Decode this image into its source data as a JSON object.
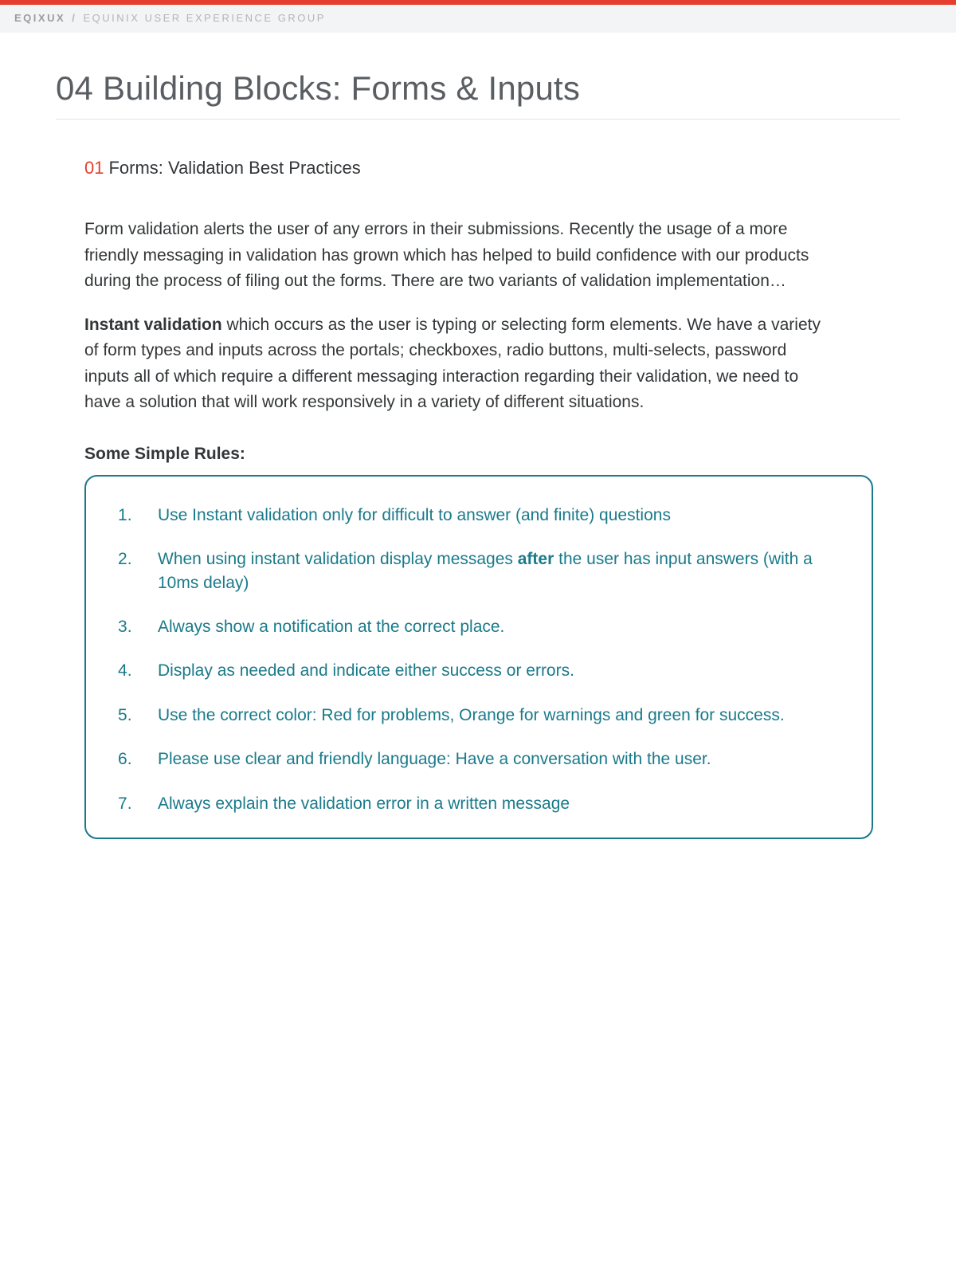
{
  "colors": {
    "accent_red": "#e53e2e",
    "rule_teal": "#1a7a8a",
    "header_bg": "#f3f4f5",
    "text_dark": "#333638",
    "title_gray": "#5a5e62"
  },
  "header": {
    "brand": "EQIXUX",
    "separator": "/",
    "group": "EQUINIX USER EXPERIENCE GROUP"
  },
  "page": {
    "title": "04 Building Blocks: Forms & Inputs"
  },
  "section": {
    "number": "01",
    "heading": "Forms: Validation Best Practices",
    "para1": "Form validation alerts the user of any errors in their submissions. Recently the usage of a more friendly messaging in validation has grown which has helped to build confidence with our products during the process of filing out the forms. There are two variants of validation implementation…",
    "para2_lead": "Instant validation",
    "para2_rest": " which occurs as the user is typing or selecting form elements. We have a variety of form types and inputs across the portals; checkboxes, radio buttons, multi-selects, password inputs all of which require a different messaging interaction regarding their validation, we need to have a solution that will work responsively in a variety of different situations.",
    "rules_heading": "Some Simple Rules:",
    "rules": [
      {
        "pre": "Use Instant validation only for difficult to answer (and finite) questions",
        "bold": "",
        "post": ""
      },
      {
        "pre": "When using instant validation display messages ",
        "bold": "after",
        "post": " the user has input answers (with a 10ms delay)"
      },
      {
        "pre": "Always show a notification at the correct place.",
        "bold": "",
        "post": ""
      },
      {
        "pre": "Display as needed and indicate either success or errors.",
        "bold": "",
        "post": ""
      },
      {
        "pre": "Use the correct color: Red for problems, Orange for warnings and green for success.",
        "bold": "",
        "post": ""
      },
      {
        "pre": "Please use clear and friendly language: Have a conversation with the user.",
        "bold": "",
        "post": ""
      },
      {
        "pre": "Always explain the validation error in a written message",
        "bold": "",
        "post": ""
      }
    ]
  }
}
